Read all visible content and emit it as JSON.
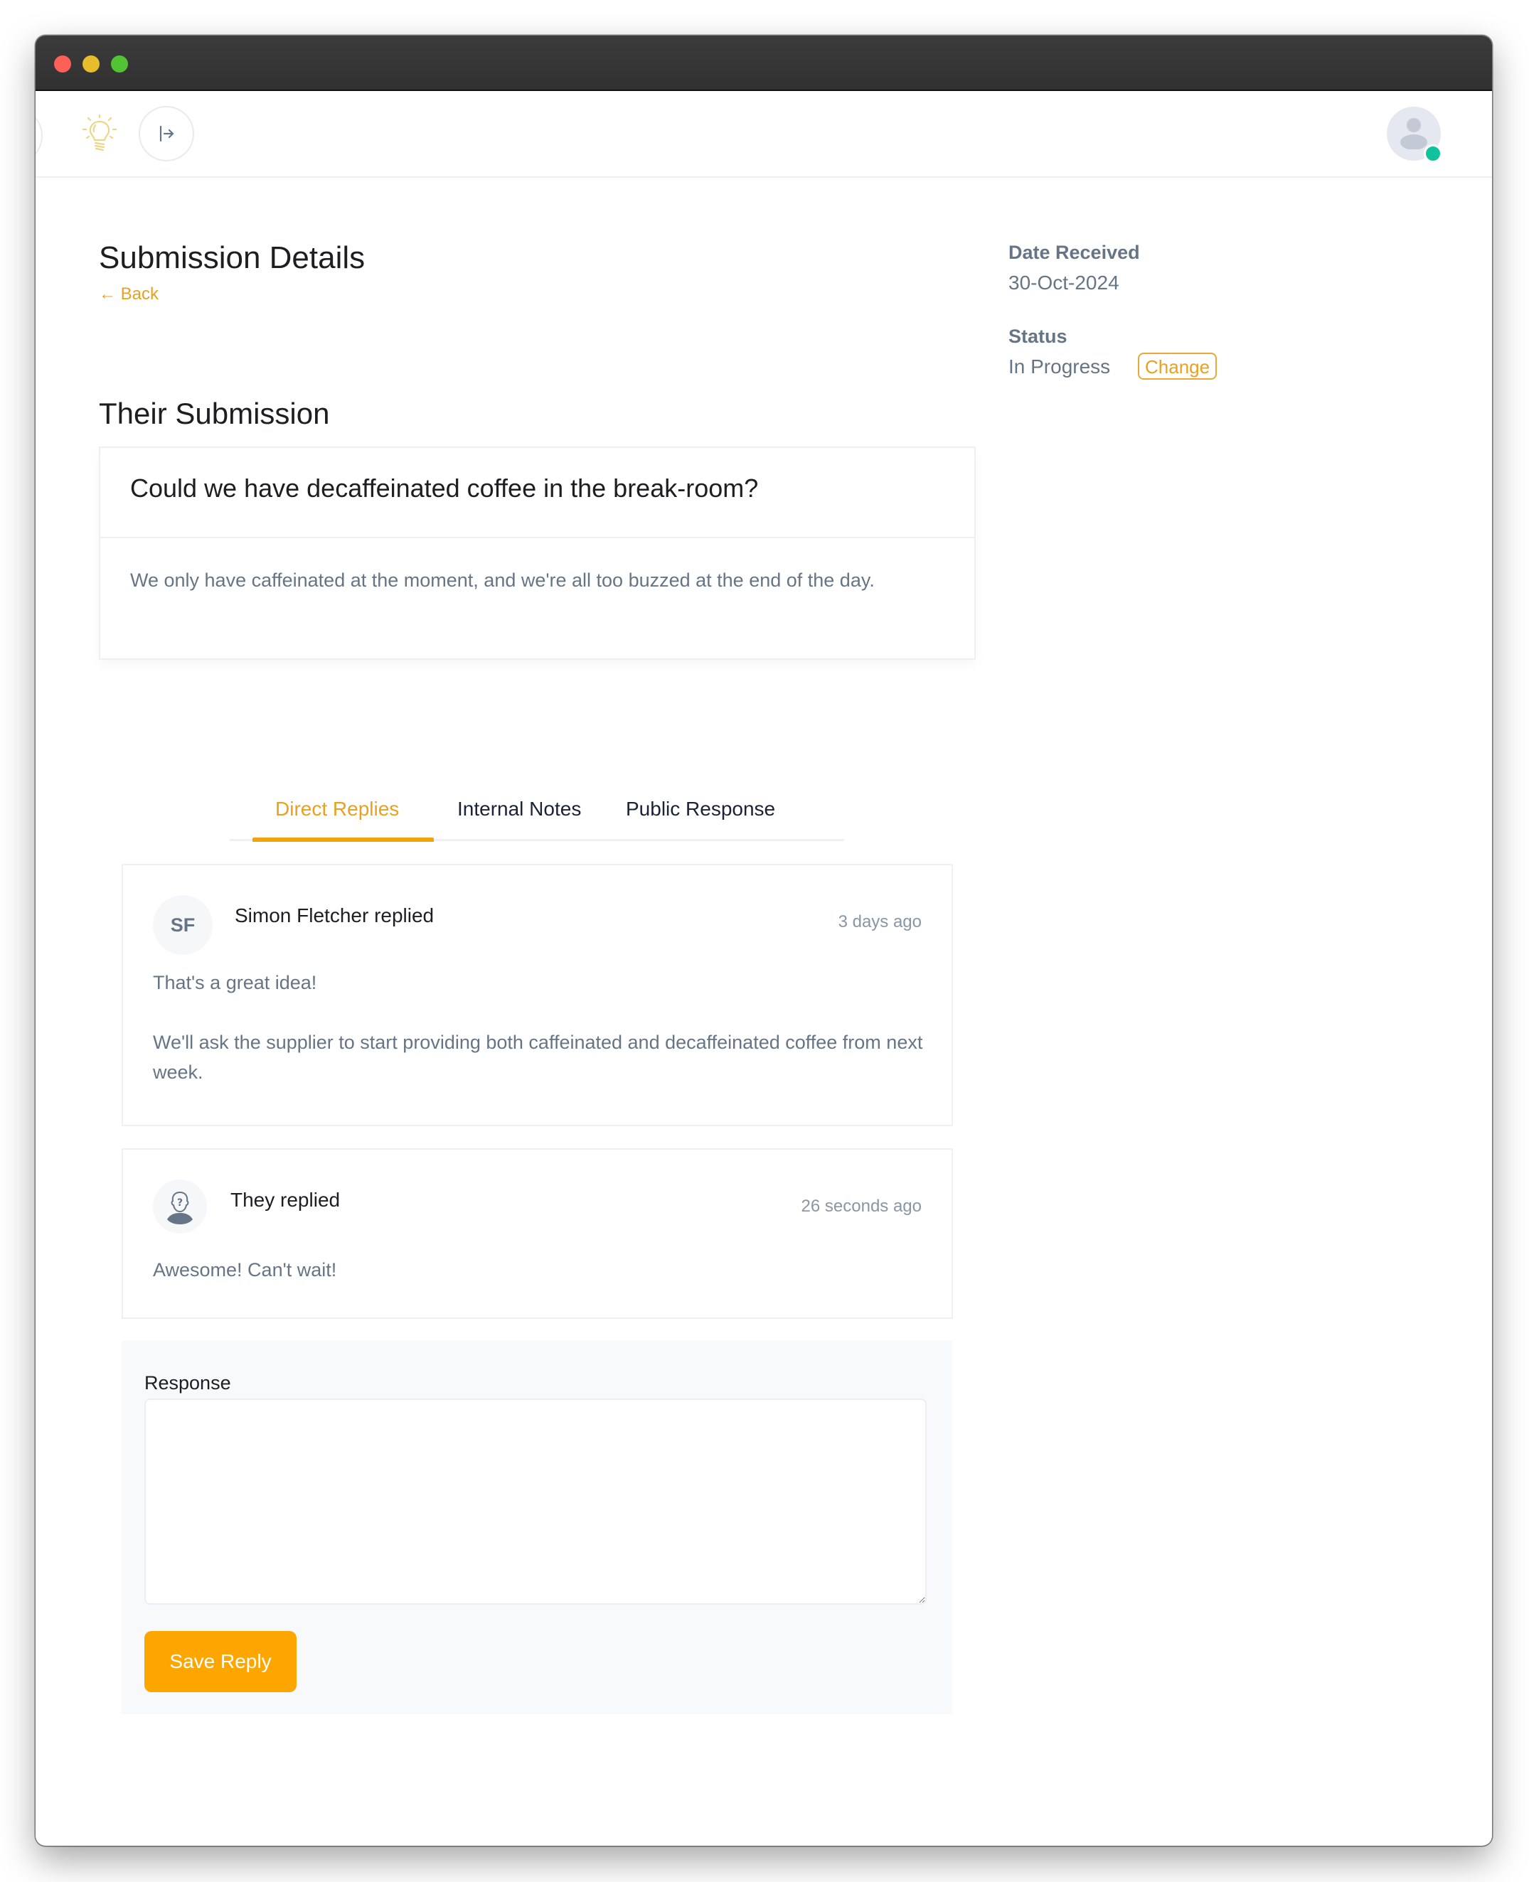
{
  "header": {
    "icons": {
      "left": "lightbulb-icon",
      "expand": "expand-sidebar-icon",
      "user": "user-avatar-icon"
    },
    "status_color": "#10c39e"
  },
  "page": {
    "title": "Submission Details",
    "back_label": "← Back"
  },
  "meta": {
    "date_label": "Date Received",
    "date_value": "30-Oct-2024",
    "status_label": "Status",
    "status_value": "In Progress",
    "change_label": "Change"
  },
  "submission": {
    "section_title": "Their Submission",
    "question": "Could we have decaffeinated coffee in the break-room?",
    "body": "We only have caffeinated at the moment, and we're all too buzzed at the end of the day."
  },
  "tabs": [
    {
      "label": "Direct Replies",
      "active": true
    },
    {
      "label": "Internal Notes",
      "active": false
    },
    {
      "label": "Public Response",
      "active": false
    }
  ],
  "replies": [
    {
      "initials": "SF",
      "author": "Simon Fletcher replied",
      "time": "3 days ago",
      "paragraphs": [
        "That's a great idea!",
        "We'll ask the supplier to start providing both caffeinated and decaffeinated coffee from next week."
      ]
    },
    {
      "avatar_icon": "anonymous-user-icon",
      "author": "They replied",
      "time": "26 seconds ago",
      "paragraphs": [
        "Awesome!  Can't wait!"
      ]
    }
  ],
  "response": {
    "label": "Response",
    "value": "",
    "placeholder": "",
    "save_label": "Save Reply"
  },
  "colors": {
    "accent": "#f0a30a",
    "button": "#fda600",
    "muted_text": "#667586"
  }
}
